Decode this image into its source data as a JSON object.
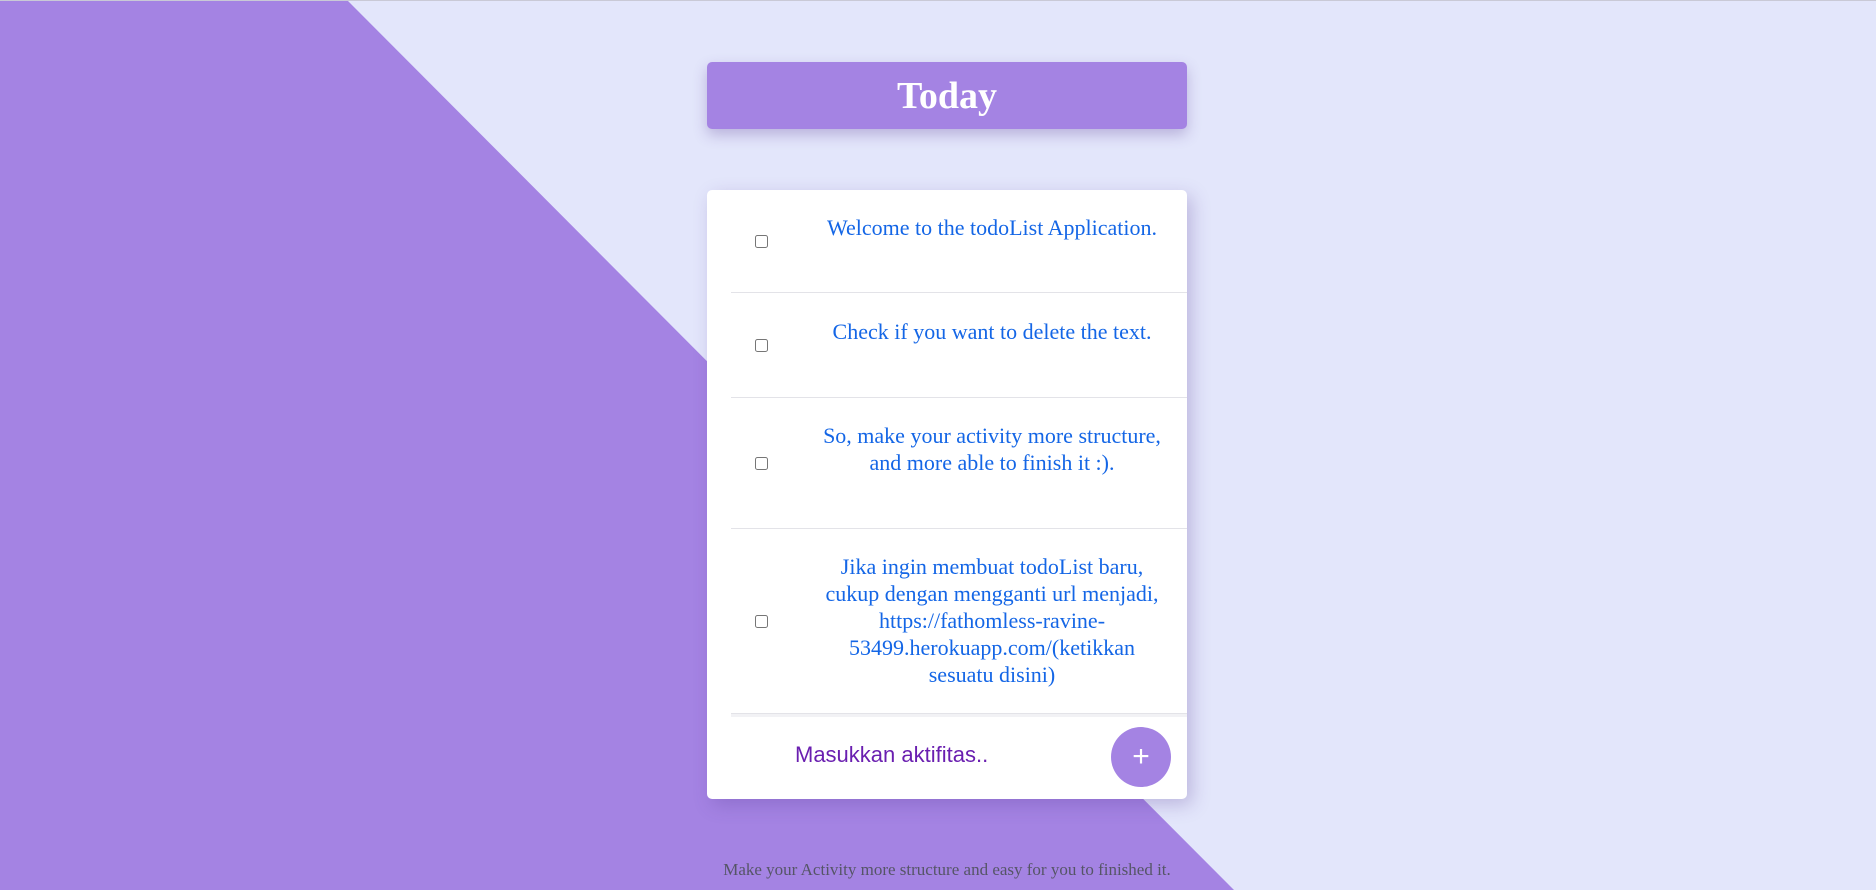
{
  "colors": {
    "page_background": "#e3e6fb",
    "accent_purple": "#a483e3",
    "item_text": "#1466e6",
    "input_text": "#6a1fb0",
    "footer_text": "#555566"
  },
  "header": {
    "title": "Today"
  },
  "todo_list": {
    "items": [
      {
        "text": "Welcome to the todoList Application.",
        "checked": false
      },
      {
        "text": "Check if you want to delete the text.",
        "checked": false
      },
      {
        "text": "So, make your activity more structure, and more able to finish it :).",
        "checked": false
      },
      {
        "text": "Jika ingin membuat todoList baru, cukup dengan mengganti url menjadi, https://fathomless-ravine-53499.herokuapp.com/(ketikkan sesuatu disini)",
        "checked": false
      }
    ],
    "new_item": {
      "placeholder": "Masukkan aktifitas..",
      "value": "",
      "add_button_label": "+",
      "add_button_icon": "plus-icon"
    }
  },
  "footer": {
    "text": "Make your Activity more structure and easy for you to finished it."
  }
}
